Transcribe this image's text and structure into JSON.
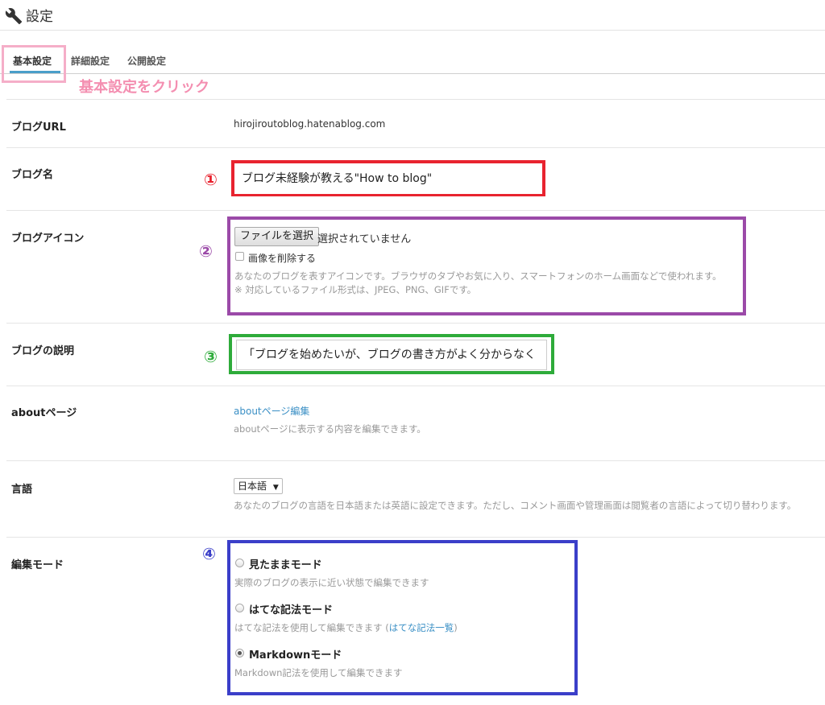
{
  "header": {
    "title": "設定"
  },
  "tabs": [
    {
      "label": "基本設定",
      "active": true
    },
    {
      "label": "詳細設定",
      "active": false
    },
    {
      "label": "公開設定",
      "active": false
    }
  ],
  "annotation": {
    "click_hint": "基本設定をクリック"
  },
  "blog_url": {
    "label": "ブログURL",
    "value": "hirojiroutoblog.hatenablog.com"
  },
  "blog_name": {
    "label": "ブログ名",
    "marker": "①",
    "value": "ブログ未経験が教える\"How to blog\""
  },
  "blog_icon": {
    "label": "ブログアイコン",
    "marker": "②",
    "file_button": "ファイルを選択",
    "file_status": "選択されていません",
    "delete_checkbox_label": "画像を削除する",
    "help1": "あなたのブログを表すアイコンです。ブラウザのタブやお気に入り、スマートフォンのホーム画面などで使われます。",
    "help2": "※ 対応しているファイル形式は、JPEG、PNG、GIFです。"
  },
  "blog_description": {
    "label": "ブログの説明",
    "marker": "③",
    "value": "「ブログを始めたいが、ブログの書き方がよく分からなく"
  },
  "about_page": {
    "label": "aboutページ",
    "link": "aboutページ編集",
    "help": "aboutページに表示する内容を編集できます。"
  },
  "language": {
    "label": "言語",
    "selected": "日本語",
    "help": "あなたのブログの言語を日本語または英語に設定できます。ただし、コメント画面や管理画面は閲覧者の言語によって切り替わります。"
  },
  "edit_mode": {
    "label": "編集モード",
    "marker": "④",
    "options": [
      {
        "label": "見たままモード",
        "help": "実際のブログの表示に近い状態で編集できます",
        "checked": false
      },
      {
        "label": "はてな記法モード",
        "help": "はてな記法を使用して編集できます (",
        "link": "はてな記法一覧",
        "help_suffix": ")",
        "checked": false
      },
      {
        "label": "Markdownモード",
        "help": "Markdown記法を使用して編集できます",
        "checked": true
      }
    ]
  },
  "colors": {
    "marker1": "#e8232f",
    "marker2": "#9b4aa8",
    "marker3": "#2eab3a",
    "marker4": "#3b3fc9",
    "highlight_pink": "#f5aec8",
    "link": "#3a8fc5"
  }
}
